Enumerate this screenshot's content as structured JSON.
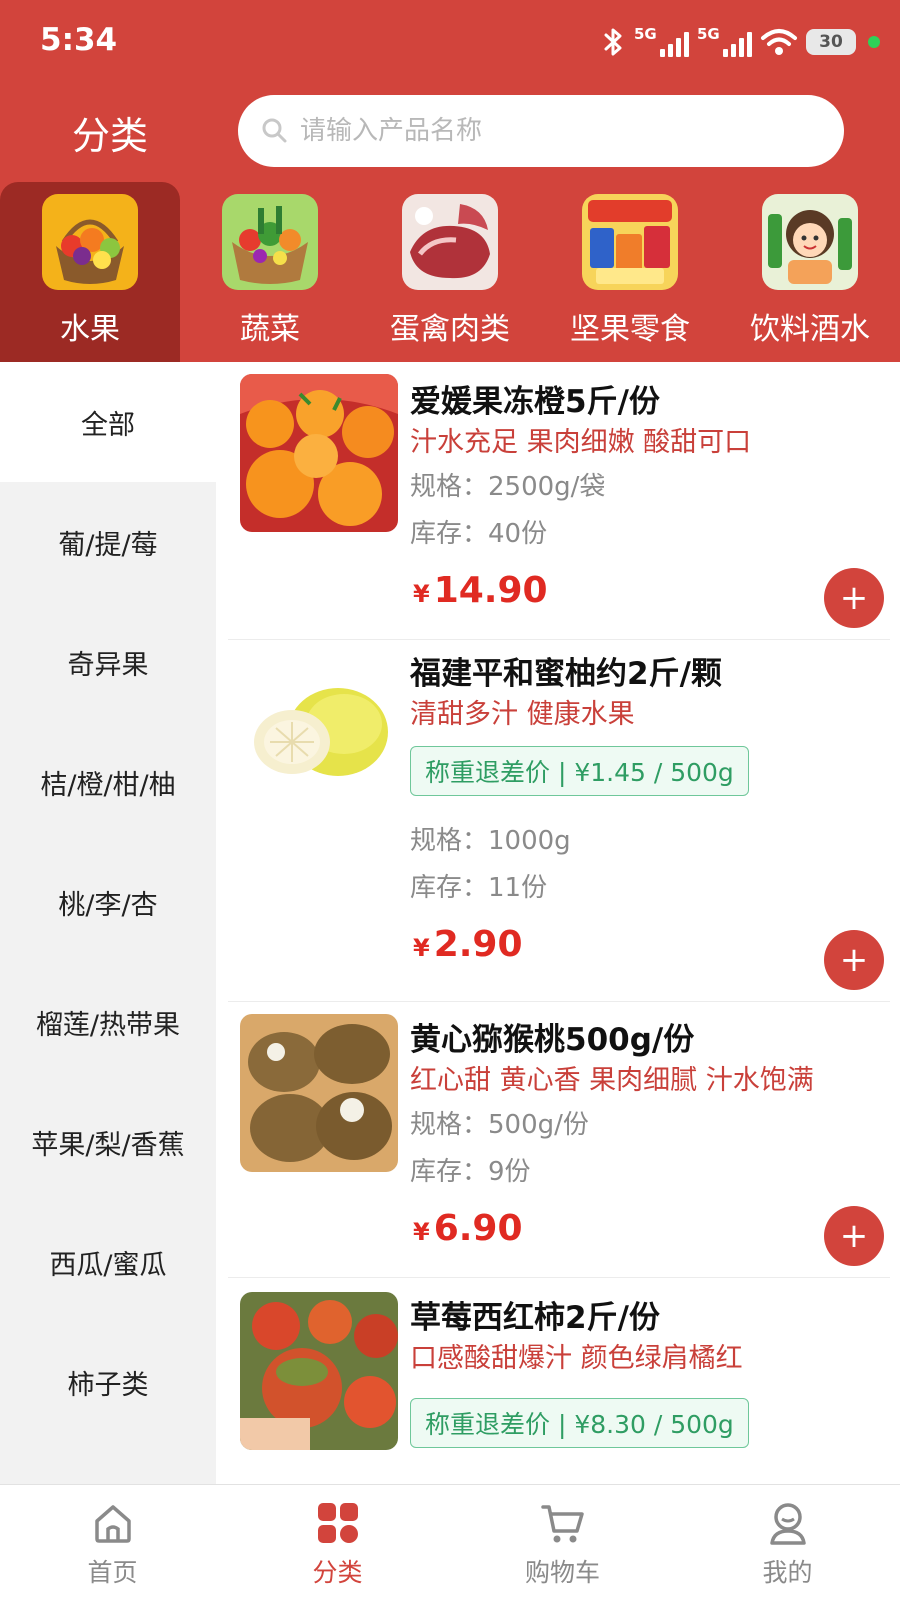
{
  "status_bar": {
    "time": "5:34",
    "net1": "5G",
    "net2": "5G",
    "battery": "30"
  },
  "header": {
    "title": "分类",
    "search_placeholder": "请输入产品名称"
  },
  "categories": [
    {
      "label": "水果",
      "icon": "fruit-basket-icon",
      "active": true
    },
    {
      "label": "蔬菜",
      "icon": "vegetable-basket-icon",
      "active": false
    },
    {
      "label": "蛋禽肉类",
      "icon": "meat-icon",
      "active": false
    },
    {
      "label": "坚果零食",
      "icon": "snacks-icon",
      "active": false
    },
    {
      "label": "饮料酒水",
      "icon": "drinks-icon",
      "active": false
    }
  ],
  "sidebar": {
    "items": [
      {
        "label": "全部",
        "active": true
      },
      {
        "label": "葡/提/莓"
      },
      {
        "label": "奇异果"
      },
      {
        "label": "桔/橙/柑/柚"
      },
      {
        "label": "桃/李/杏"
      },
      {
        "label": "榴莲/热带果"
      },
      {
        "label": "苹果/梨/香蕉"
      },
      {
        "label": "西瓜/蜜瓜"
      },
      {
        "label": "柿子类"
      }
    ]
  },
  "products": [
    {
      "name": "爱媛果冻橙5斤/份",
      "desc": "汁水充足 果肉细嫩 酸甜可口",
      "spec": "规格：2500g/袋",
      "stock": "库存：40份",
      "currency": "¥",
      "price": "14.90"
    },
    {
      "name": "福建平和蜜柚约2斤/颗",
      "desc": "清甜多汁 健康水果",
      "tag": "称重退差价 | ¥1.45 / 500g",
      "spec": "规格：1000g",
      "stock": "库存：11份",
      "currency": "¥",
      "price": "2.90"
    },
    {
      "name": "黄心猕猴桃500g/份",
      "desc": "红心甜 黄心香 果肉细腻 汁水饱满",
      "spec": "规格：500g/份",
      "stock": "库存：9份",
      "currency": "¥",
      "price": "6.90"
    },
    {
      "name": "草莓西红柿2斤/份",
      "desc": "口感酸甜爆汁 颜色绿肩橘红",
      "tag": "称重退差价 | ¥8.30 / 500g"
    }
  ],
  "add_label": "+",
  "tabbar": [
    {
      "label": "首页",
      "icon": "home-icon",
      "active": false
    },
    {
      "label": "分类",
      "icon": "category-grid-icon",
      "active": true
    },
    {
      "label": "购物车",
      "icon": "cart-icon",
      "active": false
    },
    {
      "label": "我的",
      "icon": "profile-icon",
      "active": false
    }
  ],
  "colors": {
    "brand_red": "#d2443c",
    "active_category_bg": "#9c2a24",
    "price_red": "#e02a22",
    "tag_green": "#2f9d63"
  }
}
